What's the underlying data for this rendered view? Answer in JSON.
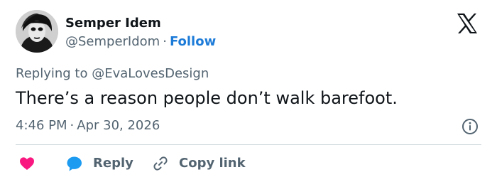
{
  "author": {
    "name": "Semper Idem",
    "handle": "@SemperIdom",
    "separator": "·",
    "follow_label": "Follow"
  },
  "brand": {
    "logo": "x-logo-icon"
  },
  "tweet": {
    "reply_prefix": "Replying to ",
    "reply_to": "@EvaLovesDesign",
    "text": "There’s a reason people don’t walk barefoot.",
    "time": "4:46 PM",
    "date": "Apr 30, 2026",
    "separator": "·"
  },
  "actions": {
    "like_icon": "heart-icon",
    "reply_icon": "speech-bubble-icon",
    "reply_label": "Reply",
    "copy_icon": "link-icon",
    "copy_label": "Copy link",
    "info_icon": "info-icon"
  },
  "colors": {
    "text": "#0f1419",
    "muted": "#536471",
    "follow": "#1d7bd8",
    "like": "#f91880",
    "reply": "#1d9bf0",
    "divider": "#cfd9de"
  }
}
